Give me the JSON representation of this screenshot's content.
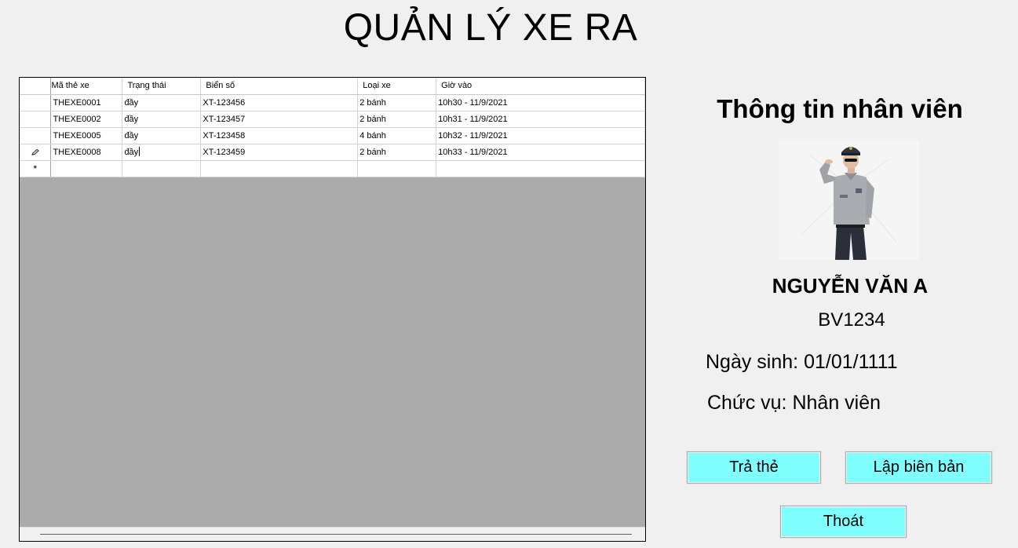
{
  "window": {
    "title": "QUẢN LÝ XE RA"
  },
  "grid": {
    "columns": [
      "Mã thẻ xe",
      "Trạng thái",
      "Biển số",
      "Loại xe",
      "Giờ vào"
    ],
    "rows": [
      [
        "THEXE0001",
        "đầy",
        "XT-123456",
        "2 bánh",
        "10h30 - 11/9/2021"
      ],
      [
        "THEXE0002",
        "đầy",
        "XT-123457",
        "2 bánh",
        "10h31 - 11/9/2021"
      ],
      [
        "THEXE0005",
        "đầy",
        "XT-123458",
        "4  bánh",
        "10h32 - 11/9/2021"
      ],
      [
        "THEXE0008",
        "đầy",
        "XT-123459",
        "2 bánh",
        "10h33 - 11/9/2021"
      ]
    ],
    "row_header_icons": {
      "editing": "pencil-icon",
      "new_row": "asterisk-icon"
    },
    "background_color": "#ababab"
  },
  "employee": {
    "heading": "Thông tin nhân viên",
    "photo_icon": "security-guard-photo",
    "name": "NGUYỄN VĂN A",
    "id": "BV1234",
    "dob_label": "Ngày sinh:",
    "dob": "01/01/1111",
    "role_label": "Chức vụ:",
    "role": "Nhân viên"
  },
  "buttons": {
    "return_card": "Trả thẻ",
    "create_report": "Lập biên bản",
    "exit": "Thoát",
    "color": "#80ffff"
  }
}
